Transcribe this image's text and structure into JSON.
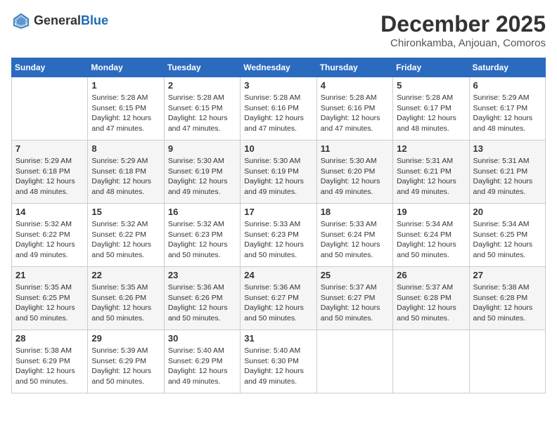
{
  "logo": {
    "general": "General",
    "blue": "Blue"
  },
  "header": {
    "month": "December 2025",
    "location": "Chironkamba, Anjouan, Comoros"
  },
  "weekdays": [
    "Sunday",
    "Monday",
    "Tuesday",
    "Wednesday",
    "Thursday",
    "Friday",
    "Saturday"
  ],
  "weeks": [
    [
      {
        "day": "",
        "info": ""
      },
      {
        "day": "1",
        "info": "Sunrise: 5:28 AM\nSunset: 6:15 PM\nDaylight: 12 hours and 47 minutes."
      },
      {
        "day": "2",
        "info": "Sunrise: 5:28 AM\nSunset: 6:15 PM\nDaylight: 12 hours and 47 minutes."
      },
      {
        "day": "3",
        "info": "Sunrise: 5:28 AM\nSunset: 6:16 PM\nDaylight: 12 hours and 47 minutes."
      },
      {
        "day": "4",
        "info": "Sunrise: 5:28 AM\nSunset: 6:16 PM\nDaylight: 12 hours and 47 minutes."
      },
      {
        "day": "5",
        "info": "Sunrise: 5:28 AM\nSunset: 6:17 PM\nDaylight: 12 hours and 48 minutes."
      },
      {
        "day": "6",
        "info": "Sunrise: 5:29 AM\nSunset: 6:17 PM\nDaylight: 12 hours and 48 minutes."
      }
    ],
    [
      {
        "day": "7",
        "info": "Sunrise: 5:29 AM\nSunset: 6:18 PM\nDaylight: 12 hours and 48 minutes."
      },
      {
        "day": "8",
        "info": "Sunrise: 5:29 AM\nSunset: 6:18 PM\nDaylight: 12 hours and 48 minutes."
      },
      {
        "day": "9",
        "info": "Sunrise: 5:30 AM\nSunset: 6:19 PM\nDaylight: 12 hours and 49 minutes."
      },
      {
        "day": "10",
        "info": "Sunrise: 5:30 AM\nSunset: 6:19 PM\nDaylight: 12 hours and 49 minutes."
      },
      {
        "day": "11",
        "info": "Sunrise: 5:30 AM\nSunset: 6:20 PM\nDaylight: 12 hours and 49 minutes."
      },
      {
        "day": "12",
        "info": "Sunrise: 5:31 AM\nSunset: 6:21 PM\nDaylight: 12 hours and 49 minutes."
      },
      {
        "day": "13",
        "info": "Sunrise: 5:31 AM\nSunset: 6:21 PM\nDaylight: 12 hours and 49 minutes."
      }
    ],
    [
      {
        "day": "14",
        "info": "Sunrise: 5:32 AM\nSunset: 6:22 PM\nDaylight: 12 hours and 49 minutes."
      },
      {
        "day": "15",
        "info": "Sunrise: 5:32 AM\nSunset: 6:22 PM\nDaylight: 12 hours and 50 minutes."
      },
      {
        "day": "16",
        "info": "Sunrise: 5:32 AM\nSunset: 6:23 PM\nDaylight: 12 hours and 50 minutes."
      },
      {
        "day": "17",
        "info": "Sunrise: 5:33 AM\nSunset: 6:23 PM\nDaylight: 12 hours and 50 minutes."
      },
      {
        "day": "18",
        "info": "Sunrise: 5:33 AM\nSunset: 6:24 PM\nDaylight: 12 hours and 50 minutes."
      },
      {
        "day": "19",
        "info": "Sunrise: 5:34 AM\nSunset: 6:24 PM\nDaylight: 12 hours and 50 minutes."
      },
      {
        "day": "20",
        "info": "Sunrise: 5:34 AM\nSunset: 6:25 PM\nDaylight: 12 hours and 50 minutes."
      }
    ],
    [
      {
        "day": "21",
        "info": "Sunrise: 5:35 AM\nSunset: 6:25 PM\nDaylight: 12 hours and 50 minutes."
      },
      {
        "day": "22",
        "info": "Sunrise: 5:35 AM\nSunset: 6:26 PM\nDaylight: 12 hours and 50 minutes."
      },
      {
        "day": "23",
        "info": "Sunrise: 5:36 AM\nSunset: 6:26 PM\nDaylight: 12 hours and 50 minutes."
      },
      {
        "day": "24",
        "info": "Sunrise: 5:36 AM\nSunset: 6:27 PM\nDaylight: 12 hours and 50 minutes."
      },
      {
        "day": "25",
        "info": "Sunrise: 5:37 AM\nSunset: 6:27 PM\nDaylight: 12 hours and 50 minutes."
      },
      {
        "day": "26",
        "info": "Sunrise: 5:37 AM\nSunset: 6:28 PM\nDaylight: 12 hours and 50 minutes."
      },
      {
        "day": "27",
        "info": "Sunrise: 5:38 AM\nSunset: 6:28 PM\nDaylight: 12 hours and 50 minutes."
      }
    ],
    [
      {
        "day": "28",
        "info": "Sunrise: 5:38 AM\nSunset: 6:29 PM\nDaylight: 12 hours and 50 minutes."
      },
      {
        "day": "29",
        "info": "Sunrise: 5:39 AM\nSunset: 6:29 PM\nDaylight: 12 hours and 50 minutes."
      },
      {
        "day": "30",
        "info": "Sunrise: 5:40 AM\nSunset: 6:29 PM\nDaylight: 12 hours and 49 minutes."
      },
      {
        "day": "31",
        "info": "Sunrise: 5:40 AM\nSunset: 6:30 PM\nDaylight: 12 hours and 49 minutes."
      },
      {
        "day": "",
        "info": ""
      },
      {
        "day": "",
        "info": ""
      },
      {
        "day": "",
        "info": ""
      }
    ]
  ]
}
